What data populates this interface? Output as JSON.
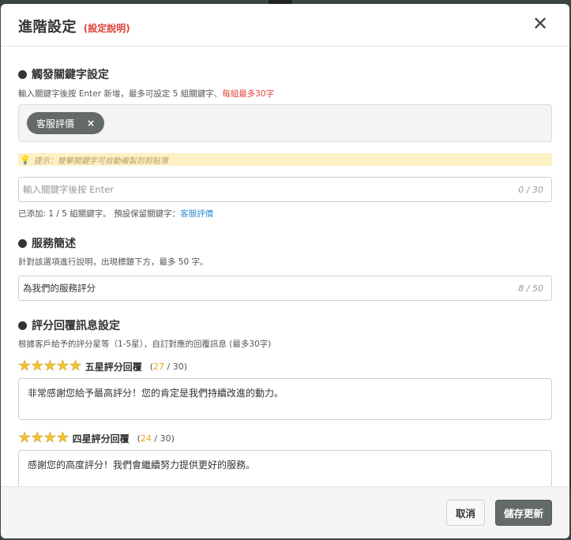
{
  "modal": {
    "title": "進階設定",
    "title_hint": "(設定說明)",
    "close_glyph": "✕"
  },
  "keywords": {
    "section_title": "觸發關鍵字設定",
    "desc_main": "輸入關鍵字後按 Enter 新增，最多可設定 5 組關鍵字、",
    "desc_limit": "每組最多30字",
    "tags": [
      {
        "label": "客服評價",
        "remove": "×"
      }
    ],
    "tip_icon": "💡",
    "tip": "提示：雙擊關鍵字可自動複製到剪貼簿",
    "input_placeholder": "輸入關鍵字後按 Enter",
    "input_counter": "0 / 30",
    "status_main": "已添加: 1 / 5 組關鍵字。 預設保留關鍵字：",
    "status_reserved": "客服評價"
  },
  "service": {
    "section_title": "服務簡述",
    "desc": "針對該選項進行說明，出現標題下方，最多 50 字。",
    "input_value": "為我們的服務評分",
    "input_counter": "8 / 50"
  },
  "rating": {
    "section_title": "評分回覆訊息設定",
    "desc": "根據客戶給予的評分星等（1-5星），自訂對應的回覆訊息 (最多30字)",
    "levels": [
      {
        "stars": 5,
        "label": "五星評分回覆",
        "count_open": "(",
        "count": "27",
        "count_rest": " / 30)",
        "message": "非常感謝您給予最高評分！您的肯定是我們持續改進的動力。"
      },
      {
        "stars": 4,
        "label": "四星評分回覆",
        "count_open": "(",
        "count": "24",
        "count_rest": " / 30)",
        "message": "感謝您的高度評分！我們會繼續努力提供更好的服務。"
      }
    ],
    "star_glyph": "★"
  },
  "footer": {
    "cancel_label": "取消",
    "save_label": "儲存更新"
  },
  "colors": {
    "primary": "#646b67",
    "accent_red": "#e0443e",
    "link_blue": "#2b8fd6",
    "count_orange": "#f0a020",
    "star_gold": "#f4c430"
  }
}
